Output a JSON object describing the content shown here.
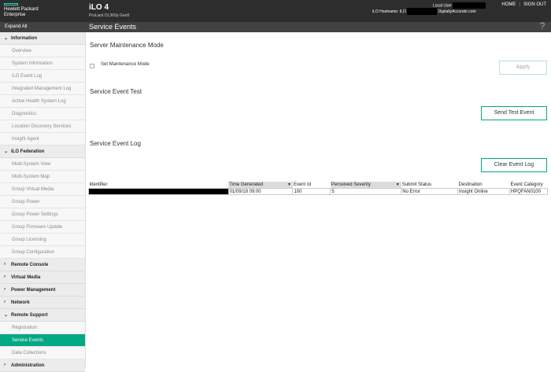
{
  "header": {
    "brand_line1": "Hewlett Packard",
    "brand_line2": "Enterprise",
    "product": "iLO 4",
    "server_model": "ProLiant DL360p Gen8",
    "hostname_label": "iLO Hostname: ILO",
    "hostname_suffix": "DigitallyAccurate.com",
    "local_user_label": "Local User",
    "home": "HOME",
    "sign_out": "SIGN OUT",
    "brand_color": "#2ad2c9"
  },
  "subbar": {
    "expand_all": "Expand All",
    "page_title": "Service Events",
    "help": "?"
  },
  "sidebar": {
    "information": {
      "label": "Information",
      "items": [
        "Overview",
        "System Information",
        "iLO Event Log",
        "Integrated Management Log",
        "Active Health System Log",
        "Diagnostics",
        "Location Discovery Services",
        "Insight Agent"
      ]
    },
    "federation": {
      "label": "iLO Federation",
      "items": [
        "Multi-System View",
        "Multi-System Map",
        "Group Virtual Media",
        "Group Power",
        "Group Power Settings",
        "Group Firmware Update",
        "Group Licensing",
        "Group Configuration"
      ]
    },
    "remote_console": "Remote Console",
    "virtual_media": "Virtual Media",
    "power_management": "Power Management",
    "network": "Network",
    "remote_support": {
      "label": "Remote Support",
      "items": [
        "Registration",
        "Service Events",
        "Data Collections"
      ]
    },
    "administration": "Administration",
    "active_color": "#00a982"
  },
  "main": {
    "maintenance_title": "Server Maintenance Mode",
    "set_maintenance_label": "Set Maintenance Mode",
    "apply_label": "Apply",
    "test_title": "Service Event Test",
    "send_test_label": "Send Test Event",
    "log_title": "Service Event Log",
    "clear_log_label": "Clear Event Log",
    "table": {
      "headers": [
        "Identifier",
        "Time Generated",
        "Event Id",
        "Perceived Severity",
        "Submit Status",
        "Destination",
        "Event Category"
      ],
      "rows": [
        [
          "",
          "01/09/18 09:00",
          "100",
          "5",
          "No Error",
          "Insight Online",
          "HPQFAN0100"
        ]
      ]
    }
  }
}
